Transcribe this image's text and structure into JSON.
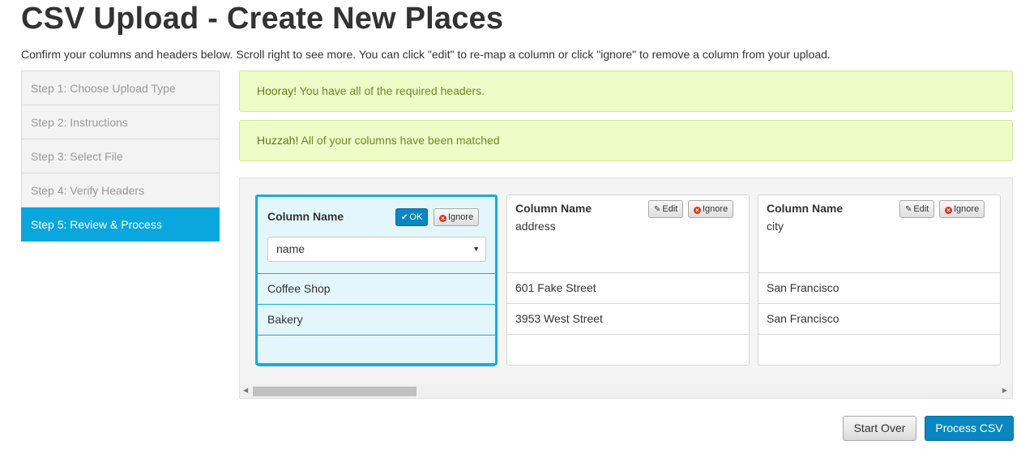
{
  "page": {
    "title": "CSV Upload - Create New Places",
    "subtitle": "Confirm your columns and headers below. Scroll right to see more. You can click \"edit\" to re-map a column or click \"ignore\" to remove a column from your upload."
  },
  "steps": [
    {
      "label": "Step 1: Choose Upload Type"
    },
    {
      "label": "Step 2: Instructions"
    },
    {
      "label": "Step 3: Select File"
    },
    {
      "label": "Step 4: Verify Headers"
    },
    {
      "label": "Step 5: Review & Process"
    }
  ],
  "alerts": [
    {
      "strong": "Hooray!",
      "text": " You have all of the required headers."
    },
    {
      "strong": "Huzzah!",
      "text": " All of your columns have been matched"
    }
  ],
  "columns": [
    {
      "title": "Column Name",
      "ok_label": "OK",
      "ignore_label": "Ignore",
      "selected_value": "name",
      "cells": [
        "Coffee Shop",
        "Bakery",
        ""
      ]
    },
    {
      "title": "Column Name",
      "field": "address",
      "edit_label": "Edit",
      "ignore_label": "Ignore",
      "cells": [
        "601 Fake Street",
        "3953 West Street",
        ""
      ]
    },
    {
      "title": "Column Name",
      "field": "city",
      "edit_label": "Edit",
      "ignore_label": "Ignore",
      "cells": [
        "San Francisco",
        "San Francisco",
        ""
      ]
    }
  ],
  "footer": {
    "start_over_label": "Start Over",
    "process_label": "Process CSV"
  },
  "colors": {
    "accent": "#0aa7de",
    "button_primary": "#0a87c0",
    "alert_bg": "#eefcc8",
    "alert_text": "#6f8b22",
    "selected_col_bg": "#e3f6fb"
  }
}
